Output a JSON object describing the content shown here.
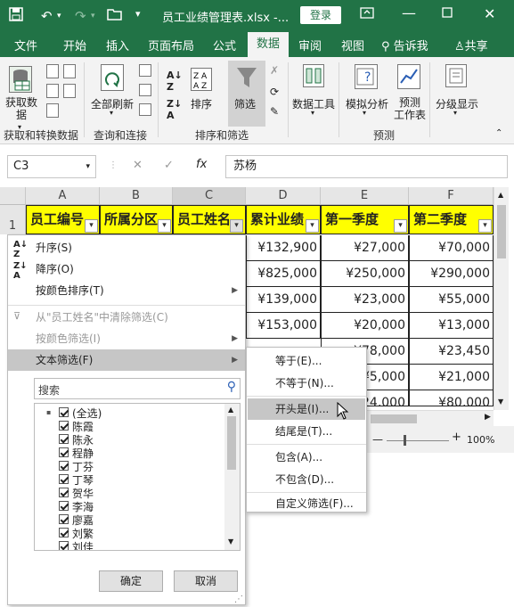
{
  "titlebar": {
    "filename": "员工业绩管理表.xlsx",
    "dash": "-...",
    "login": "登录"
  },
  "tabs": [
    "文件",
    "开始",
    "插入",
    "页面布局",
    "公式",
    "数据",
    "审阅",
    "视图"
  ],
  "tell_me": "告诉我",
  "share": "共享",
  "ribbon": {
    "get_data_label": "获取数\n据",
    "refresh_all_label": "全部刷新",
    "sort_label": "排序",
    "filter_label": "筛选",
    "data_tools_label": "数据工具",
    "whatif_label": "模拟分析",
    "forecast_label": "预测\n工作表",
    "outline_label": "分级显示",
    "groups": [
      "获取和转换数据",
      "查询和连接",
      "排序和筛选",
      "预测"
    ]
  },
  "formula_bar": {
    "name_box": "C3",
    "cancel": "✕",
    "enter": "✓",
    "fx": "fx",
    "content": "苏杨"
  },
  "columns": [
    "A",
    "B",
    "C",
    "D",
    "E",
    "F"
  ],
  "row1": "1",
  "headers": [
    "员工编号",
    "所属分区",
    "员工姓名",
    "累计业绩",
    "第一季度",
    "第二季度"
  ],
  "rows": [
    [
      "¥132,900",
      "¥27,000",
      "¥70,000"
    ],
    [
      "¥825,000",
      "¥250,000",
      "¥290,000"
    ],
    [
      "¥139,000",
      "¥23,000",
      "¥55,000"
    ],
    [
      "¥153,000",
      "¥20,000",
      "¥13,000"
    ],
    [
      "",
      "¥78,000",
      "¥23,450"
    ],
    [
      "",
      "¥5,000",
      "¥21,000"
    ],
    [
      "",
      "¥24,000",
      "¥80,000"
    ]
  ],
  "menu": {
    "sort_asc": "升序(S)",
    "sort_desc": "降序(O)",
    "sort_color": "按颜色排序(T)",
    "clear_filter": "从\"员工姓名\"中清除筛选(C)",
    "filter_color": "按颜色筛选(I)",
    "text_filter": "文本筛选(F)",
    "search_placeholder": "搜索",
    "items": [
      "(全选)",
      "陈霞",
      "陈永",
      "程静",
      "丁芬",
      "丁琴",
      "贺华",
      "李海",
      "廖嘉",
      "刘繁",
      "刘佳"
    ],
    "ok": "确定",
    "cancel": "取消"
  },
  "submenu": [
    "等于(E)...",
    "不等于(N)...",
    "开头是(I)...",
    "结尾是(T)...",
    "包含(A)...",
    "不包含(D)...",
    "自定义筛选(F)..."
  ],
  "zoom": "100%",
  "colors": {
    "excel_green": "#217346",
    "header_yellow": "#ffff00"
  }
}
